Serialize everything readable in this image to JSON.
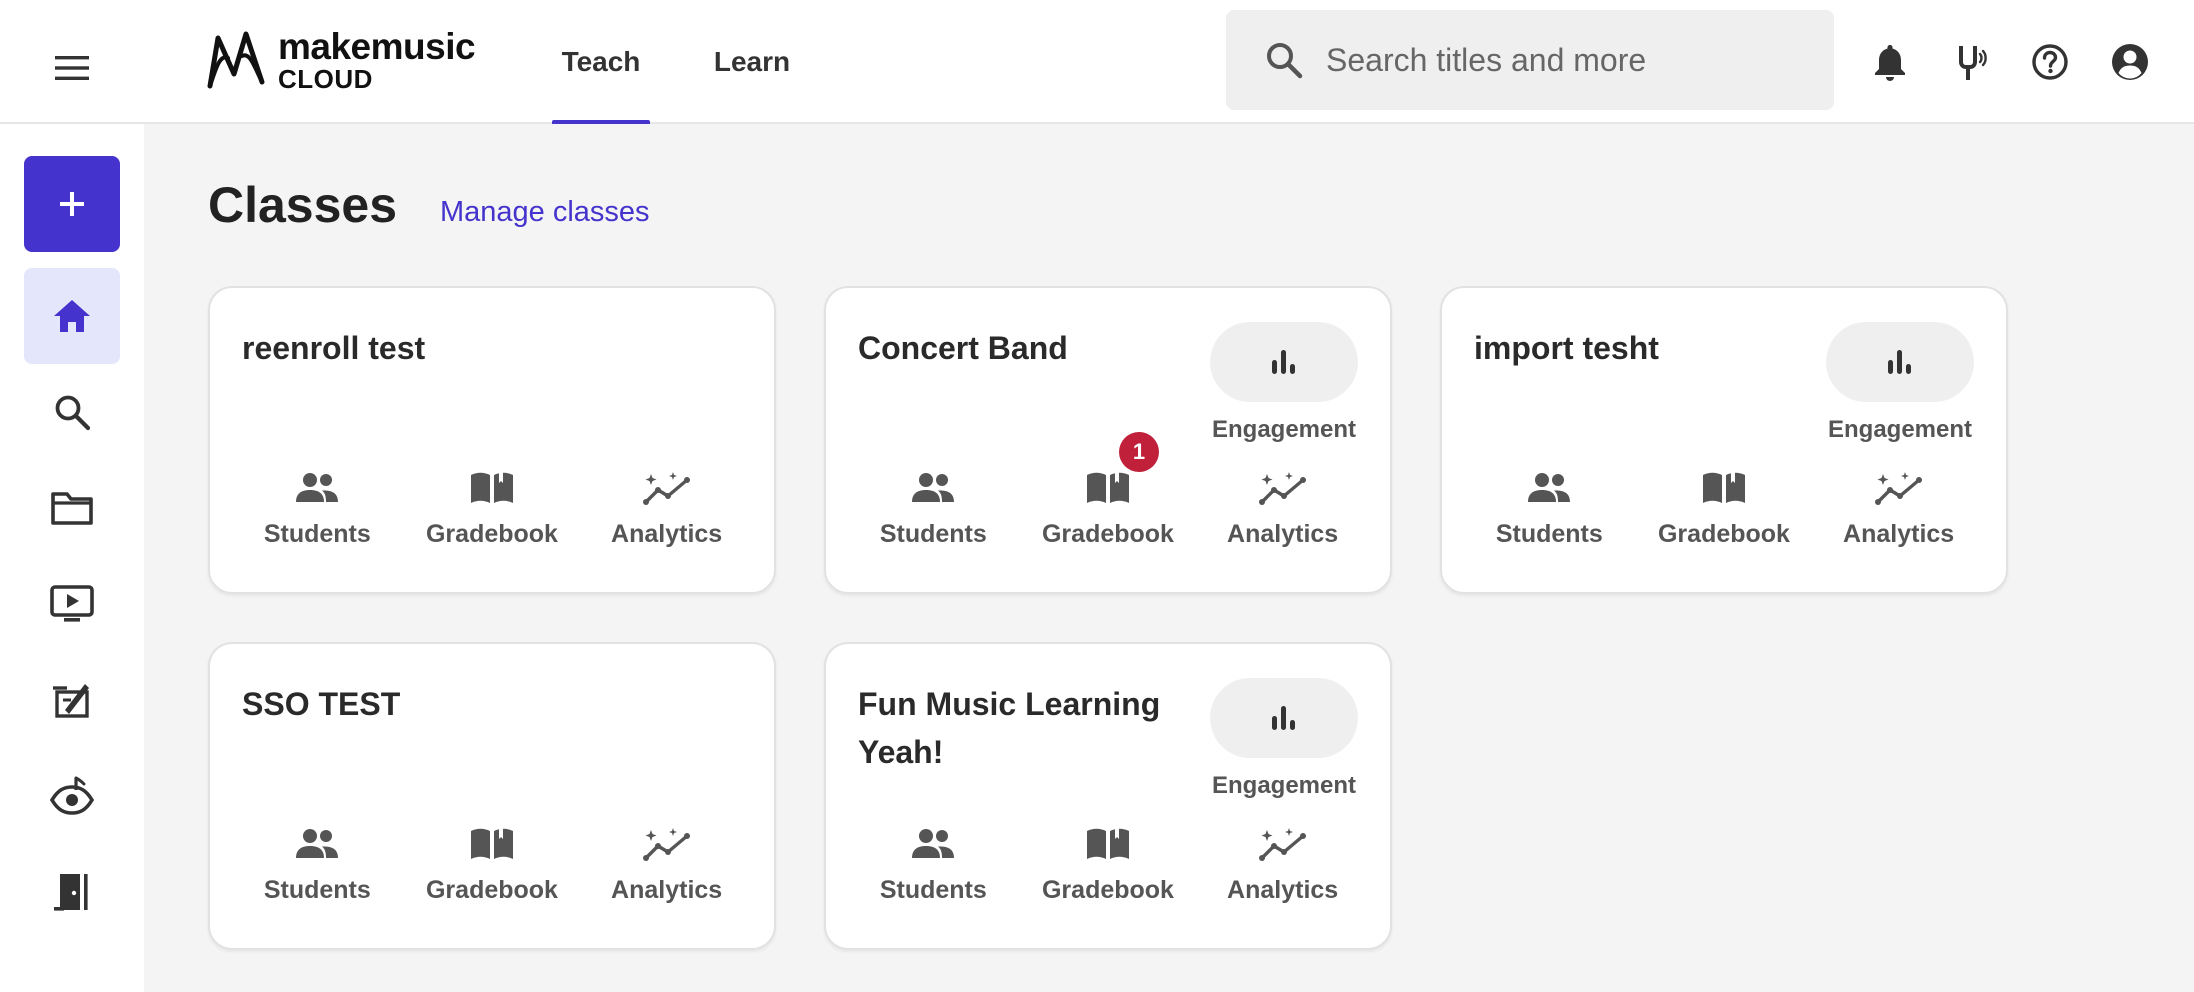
{
  "header": {
    "logo_top": "makemusic",
    "logo_bottom": "CLOUD",
    "tabs": [
      {
        "label": "Teach",
        "active": true
      },
      {
        "label": "Learn",
        "active": false
      }
    ],
    "search": {
      "placeholder": "Search titles and more",
      "value": ""
    },
    "icons": [
      "bell-icon",
      "tuning-fork-icon",
      "help-icon",
      "account-icon"
    ]
  },
  "sidebar": {
    "items": [
      "add-icon",
      "home-icon",
      "search-icon",
      "folder-icon",
      "video-icon",
      "assignment-icon",
      "eye-music-icon",
      "exit-icon"
    ]
  },
  "main": {
    "title": "Classes",
    "manage_link": "Manage classes",
    "cards": [
      {
        "name": "reenroll test",
        "engagement": false,
        "gradebook_badge": null
      },
      {
        "name": "Concert Band",
        "engagement": true,
        "gradebook_badge": "1"
      },
      {
        "name": "import tesht",
        "engagement": true,
        "gradebook_badge": null
      },
      {
        "name": "SSO TEST",
        "engagement": false,
        "gradebook_badge": null
      },
      {
        "name": "Fun Music Learning Yeah!",
        "engagement": true,
        "gradebook_badge": null
      }
    ],
    "labels": {
      "engagement": "Engagement",
      "students": "Students",
      "gradebook": "Gradebook",
      "analytics": "Analytics"
    }
  },
  "colors": {
    "accent": "#4433cc",
    "badge": "#c0203a",
    "active_nav_bg": "#e4e6fb"
  }
}
